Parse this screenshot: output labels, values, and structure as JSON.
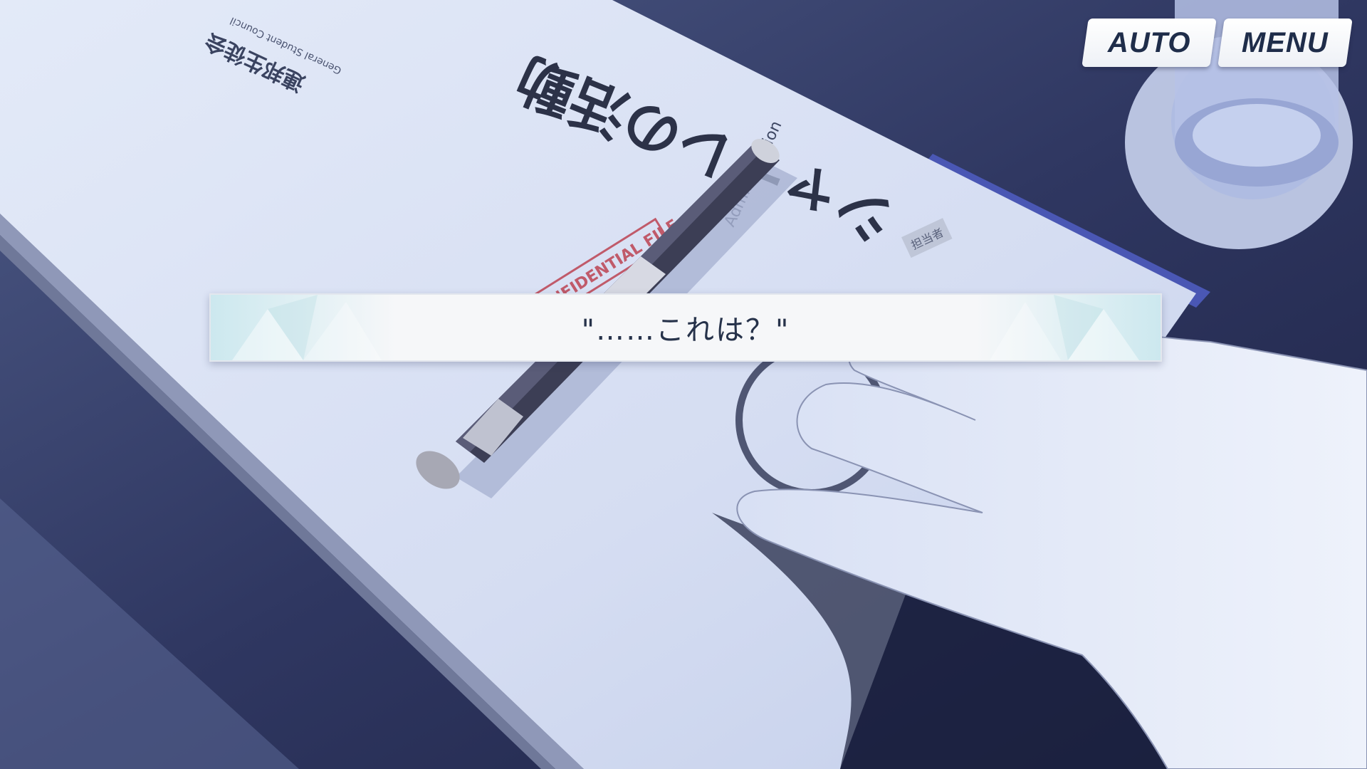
{
  "controls": {
    "auto_label": "AUTO",
    "menu_label": "MENU"
  },
  "dialogue": {
    "line": "\"……これは？\""
  },
  "scene": {
    "document_header_title": "連邦生徒会",
    "document_header_subtitle": "General Student Council",
    "document_stamp": "CONFIDENTIAL FILE",
    "document_big_title": "シャーレの活動",
    "document_side_text": "Administration",
    "document_badge": "担当者"
  },
  "colors": {
    "desk": "#2b3155",
    "paper": "#dce4f6",
    "folder": "#4a57b4",
    "ui_text": "#1f2d4a"
  }
}
